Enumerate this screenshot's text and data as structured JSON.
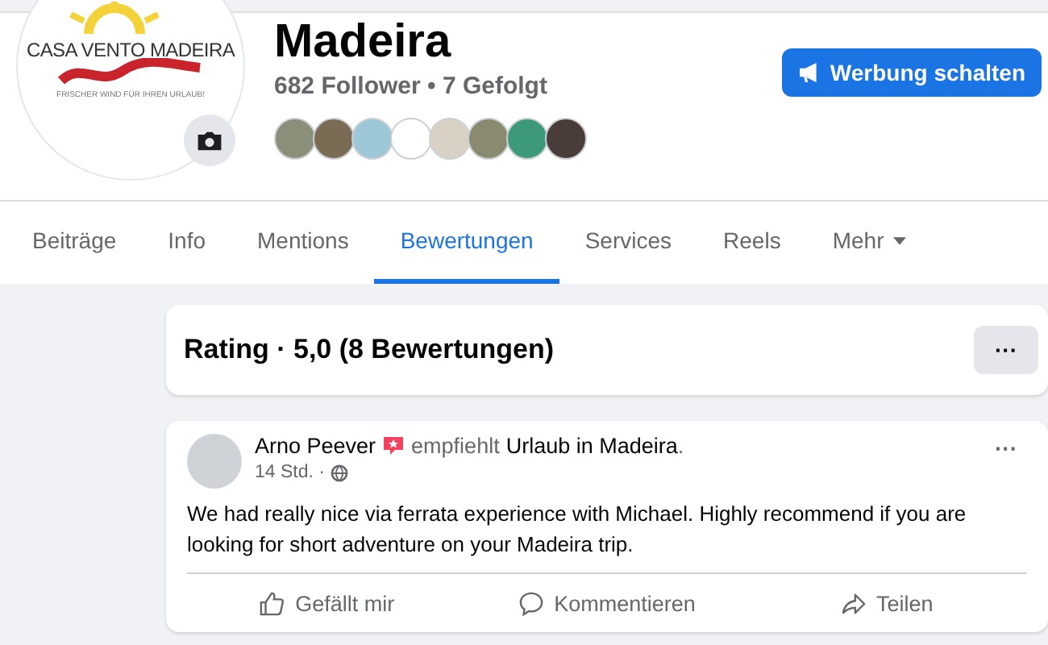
{
  "page": {
    "logo_title": "CASA VENTO MADEIRA",
    "logo_tagline": "FRISCHER WIND FÜR IHREN URLAUB!",
    "name": "Madeira",
    "stats": "682 Follower • 7 Gefolgt",
    "ad_button": "Werbung schalten"
  },
  "tabs": [
    {
      "label": "Beiträge",
      "selected": false,
      "dropdown": false
    },
    {
      "label": "Info",
      "selected": false,
      "dropdown": false
    },
    {
      "label": "Mentions",
      "selected": false,
      "dropdown": false
    },
    {
      "label": "Bewertungen",
      "selected": true,
      "dropdown": false
    },
    {
      "label": "Services",
      "selected": false,
      "dropdown": false
    },
    {
      "label": "Reels",
      "selected": false,
      "dropdown": false
    },
    {
      "label": "Mehr",
      "selected": false,
      "dropdown": true
    }
  ],
  "rating": {
    "title": "Rating · 5,0 (8 Bewertungen)",
    "menu": "···"
  },
  "review": {
    "author": "Arno Peever",
    "verb": "empfiehlt",
    "target": "Urlaub in Madeira",
    "target_end": ".",
    "time": "14 Std. ·",
    "menu": "···",
    "text": "We had really nice via ferrata experience with Michael. Highly recommend if you are looking for short adventure on your Madeira trip.",
    "actions": [
      "Gefällt mir",
      "Kommentieren",
      "Teilen"
    ]
  }
}
